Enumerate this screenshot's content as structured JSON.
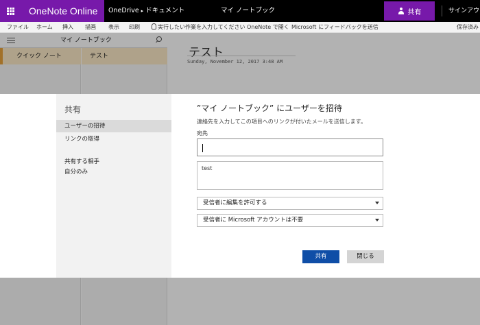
{
  "topbar": {
    "app_name": "OneNote Online",
    "breadcrumb_root": "OneDrive",
    "breadcrumb_sep": "▸",
    "breadcrumb_folder": "ドキュメント",
    "doc_title": "マイ ノートブック",
    "share_label": "共有",
    "signin_label": "サインアウ",
    "brand_color": "#7719aa"
  },
  "ribbon": {
    "tabs": [
      "ファイル",
      "ホーム",
      "挿入",
      "描画",
      "表示",
      "印刷"
    ],
    "tellme": "実行したい作業を入力してください",
    "open_in_desktop": "OneNote で開く",
    "feedback": "Microsoft にフィードバックを送信",
    "save_status": "保存済み"
  },
  "navigation": {
    "notebook_name": "マイ ノートブック",
    "section": "クイック ノート",
    "page": "テスト"
  },
  "page": {
    "title": "テスト",
    "date": "Sunday, November 12, 2017   3:48 AM"
  },
  "dialog": {
    "side_title": "共有",
    "side_items": [
      "ユーザーの招待",
      "リンクの取得"
    ],
    "shared_with_heading": "共有する相手",
    "shared_with_value": "自分のみ",
    "title": "”マイ ノートブック” にユーザーを招待",
    "description": "連絡先を入力してこの項目へのリンクが付いたメールを送信します。",
    "to_label": "宛先",
    "to_value": "",
    "message": "test",
    "permission_select": "受信者に編集を許可する",
    "account_select": "受信者に Microsoft アカウントは不要",
    "share_button": "共有",
    "close_button": "閉じる",
    "primary_color": "#0f4ea7"
  }
}
